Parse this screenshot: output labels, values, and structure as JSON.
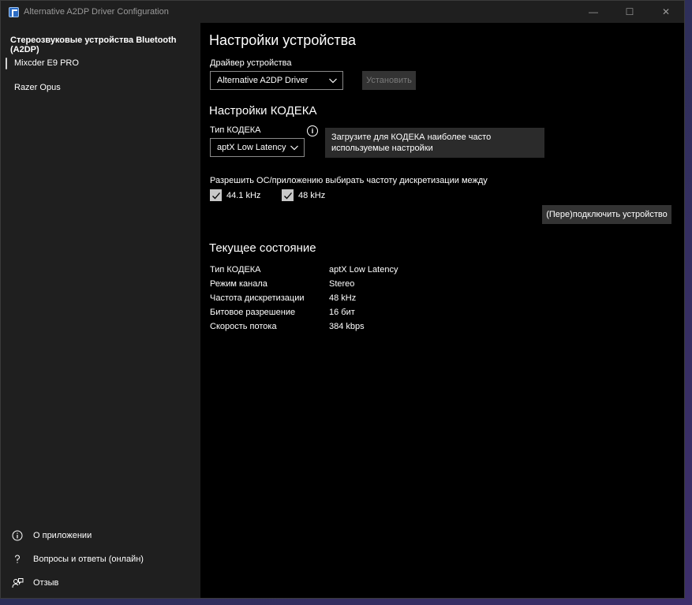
{
  "window": {
    "title": "Alternative A2DP Driver Configuration",
    "controls": {
      "minimize": "—",
      "maximize": "☐",
      "close": "✕"
    }
  },
  "sidebar": {
    "header": "Стереозвуковые устройства Bluetooth (A2DP)",
    "devices": [
      {
        "label": "Mixcder E9 PRO",
        "selected": true
      },
      {
        "label": "Razer Opus",
        "selected": false
      }
    ],
    "footer": [
      {
        "label": "О приложении",
        "icon": "info-icon"
      },
      {
        "label": "Вопросы и ответы (онлайн)",
        "icon": "question-icon"
      },
      {
        "label": "Отзыв",
        "icon": "feedback-icon"
      }
    ]
  },
  "main": {
    "title": "Настройки устройства",
    "driver": {
      "label": "Драйвер устройства",
      "selected": "Alternative A2DP Driver",
      "install_label": "Установить"
    },
    "codec_section": {
      "title": "Настройки КОДЕКА",
      "type_label": "Тип КОДЕКА",
      "selected": "aptX Low Latency",
      "tooltip": "Загрузите для КОДЕКА наиболее часто используемые настройки"
    },
    "sample_rates": {
      "label": "Разрешить ОС/приложению выбирать частоту дискретизации между",
      "options": [
        {
          "label": "44.1 kHz",
          "checked": true
        },
        {
          "label": "48 kHz",
          "checked": true
        }
      ]
    },
    "reconnect_label": "(Пере)подключить устройство",
    "status": {
      "title": "Текущее состояние",
      "rows": [
        {
          "key": "Тип КОДЕКА",
          "value": "aptX Low Latency"
        },
        {
          "key": "Режим канала",
          "value": "Stereo"
        },
        {
          "key": "Частота дискретизации",
          "value": "48 kHz"
        },
        {
          "key": "Битовое разрешение",
          "value": "16 бит"
        },
        {
          "key": "Скорость потока",
          "value": "384 kbps"
        }
      ]
    }
  }
}
